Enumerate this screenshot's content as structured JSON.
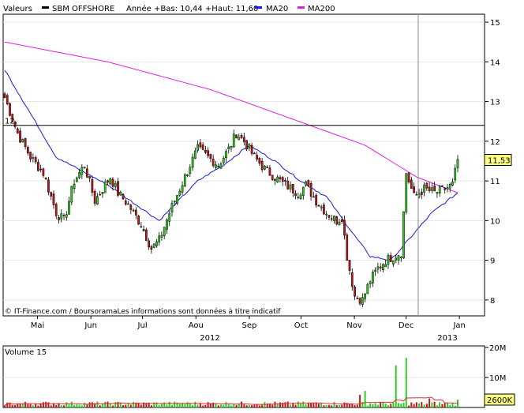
{
  "header": {
    "valeurs_label": "Valeurs",
    "series_name": "SBM OFFSHORE",
    "stats": "Année +Bas: 10,44 +Haut: 11,60",
    "ma20_label": "MA20",
    "ma200_label": "MA200"
  },
  "footer_note": "© IT-Finance.com / BoursoramaLes informations sont données à titre indicatif",
  "colors": {
    "up": "#2ecc1f",
    "down": "#c41616",
    "ma20": "#1a1ae0",
    "ma200": "#e01ee0",
    "last_label_bg": "#ffff80",
    "volume_avg": "#d03030"
  },
  "chart_data": [
    {
      "type": "candlestick",
      "title": "SBM OFFSHORE",
      "ylim": [
        7.6,
        15.2
      ],
      "yticks": [
        "15",
        "14",
        "13",
        "12",
        "11",
        "10",
        "9",
        "8"
      ],
      "month_labels": [
        "Mai",
        "Jun",
        "Jul",
        "Aou",
        "Sep",
        "Oct",
        "Nov",
        "Dec",
        "Jan"
      ],
      "year_labels": [
        "2012",
        "2013"
      ],
      "reference_line": {
        "value": 12.4,
        "label": "12,"
      },
      "last_value_label": "11,53",
      "start_date": "2012-04-26",
      "end_date": "2013-01-14",
      "close_keyframes": [
        [
          0,
          13.1
        ],
        [
          5,
          12.2
        ],
        [
          10,
          11.6
        ],
        [
          15,
          11.2
        ],
        [
          20,
          10.2
        ],
        [
          23,
          10.0
        ],
        [
          27,
          11.0
        ],
        [
          31,
          11.4
        ],
        [
          35,
          10.5
        ],
        [
          39,
          10.9
        ],
        [
          41,
          11.1
        ],
        [
          44,
          10.7
        ],
        [
          48,
          10.4
        ],
        [
          53,
          9.9
        ],
        [
          57,
          9.3
        ],
        [
          60,
          9.5
        ],
        [
          64,
          10.2
        ],
        [
          68,
          10.8
        ],
        [
          72,
          11.4
        ],
        [
          75,
          11.8
        ],
        [
          79,
          11.6
        ],
        [
          83,
          11.4
        ],
        [
          87,
          11.8
        ],
        [
          90,
          12.2
        ],
        [
          93,
          12.0
        ],
        [
          97,
          11.6
        ],
        [
          101,
          11.3
        ],
        [
          105,
          11.1
        ],
        [
          109,
          10.9
        ],
        [
          114,
          10.7
        ],
        [
          117,
          10.9
        ],
        [
          121,
          10.5
        ],
        [
          125,
          10.2
        ],
        [
          129,
          10.0
        ],
        [
          131,
          10.1
        ],
        [
          133,
          9.1
        ],
        [
          136,
          8.1
        ],
        [
          139,
          8.0
        ],
        [
          142,
          8.5
        ],
        [
          145,
          8.8
        ],
        [
          148,
          9.0
        ],
        [
          151,
          9.1
        ],
        [
          154,
          9.2
        ],
        [
          156,
          11.2
        ],
        [
          159,
          10.6
        ],
        [
          163,
          10.8
        ],
        [
          167,
          10.7
        ],
        [
          171,
          10.8
        ],
        [
          174,
          10.9
        ],
        [
          176,
          11.53
        ]
      ],
      "ma20_keyframes": [
        [
          0,
          13.8
        ],
        [
          20,
          11.6
        ],
        [
          40,
          10.9
        ],
        [
          60,
          10.0
        ],
        [
          75,
          11.0
        ],
        [
          85,
          11.4
        ],
        [
          95,
          11.9
        ],
        [
          105,
          11.5
        ],
        [
          115,
          11.0
        ],
        [
          125,
          10.6
        ],
        [
          135,
          9.7
        ],
        [
          142,
          9.1
        ],
        [
          150,
          9.0
        ],
        [
          158,
          9.6
        ],
        [
          166,
          10.2
        ],
        [
          176,
          10.7
        ]
      ],
      "ma200_keyframes": [
        [
          0,
          14.5
        ],
        [
          40,
          14.0
        ],
        [
          80,
          13.3
        ],
        [
          110,
          12.6
        ],
        [
          140,
          11.9
        ],
        [
          160,
          11.1
        ],
        [
          176,
          10.7
        ]
      ]
    },
    {
      "type": "bar",
      "title": "Volume 15",
      "ytick_labels": [
        "20M",
        "10M"
      ],
      "ylim": [
        0,
        20000000
      ],
      "last_value_label": "2600K",
      "spikes": [
        [
          138,
          4200000
        ],
        [
          140,
          5500000
        ],
        [
          152,
          14000000
        ],
        [
          156,
          16500000
        ],
        [
          165,
          3000000
        ],
        [
          176,
          2600000
        ]
      ]
    }
  ]
}
